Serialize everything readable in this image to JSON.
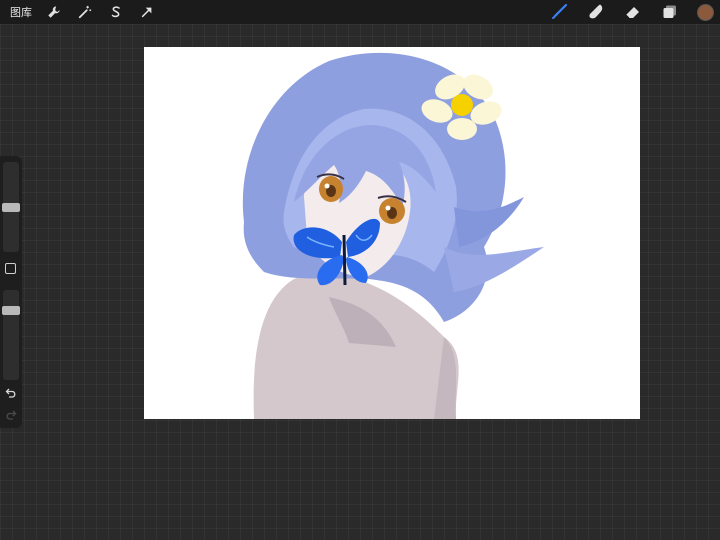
{
  "topbar": {
    "gallery_label": "图库",
    "left_tools": [
      "wrench-icon",
      "magic-wand-icon",
      "selection-icon",
      "transform-arrow-icon"
    ],
    "right_tools": [
      "brush-icon",
      "smudge-icon",
      "eraser-icon",
      "layers-icon"
    ],
    "active_tool": "brush-icon",
    "active_tool_color": "#3b82f6",
    "current_color": "#8b5a3c"
  },
  "sidebar": {
    "brush_size_level": 0.5,
    "opacity_level": 0.8,
    "tools": [
      "modify-square-icon",
      "undo-icon",
      "redo-icon"
    ]
  },
  "canvas": {
    "background": "#ffffff",
    "hair_color": "#8fa0e0",
    "skin_color": "#d6c9cc",
    "eye_color": "#c6822f",
    "butterfly_color": "#1f5fe0",
    "flower_color": "#fbf6d6",
    "flower_center": "#f6d100"
  }
}
